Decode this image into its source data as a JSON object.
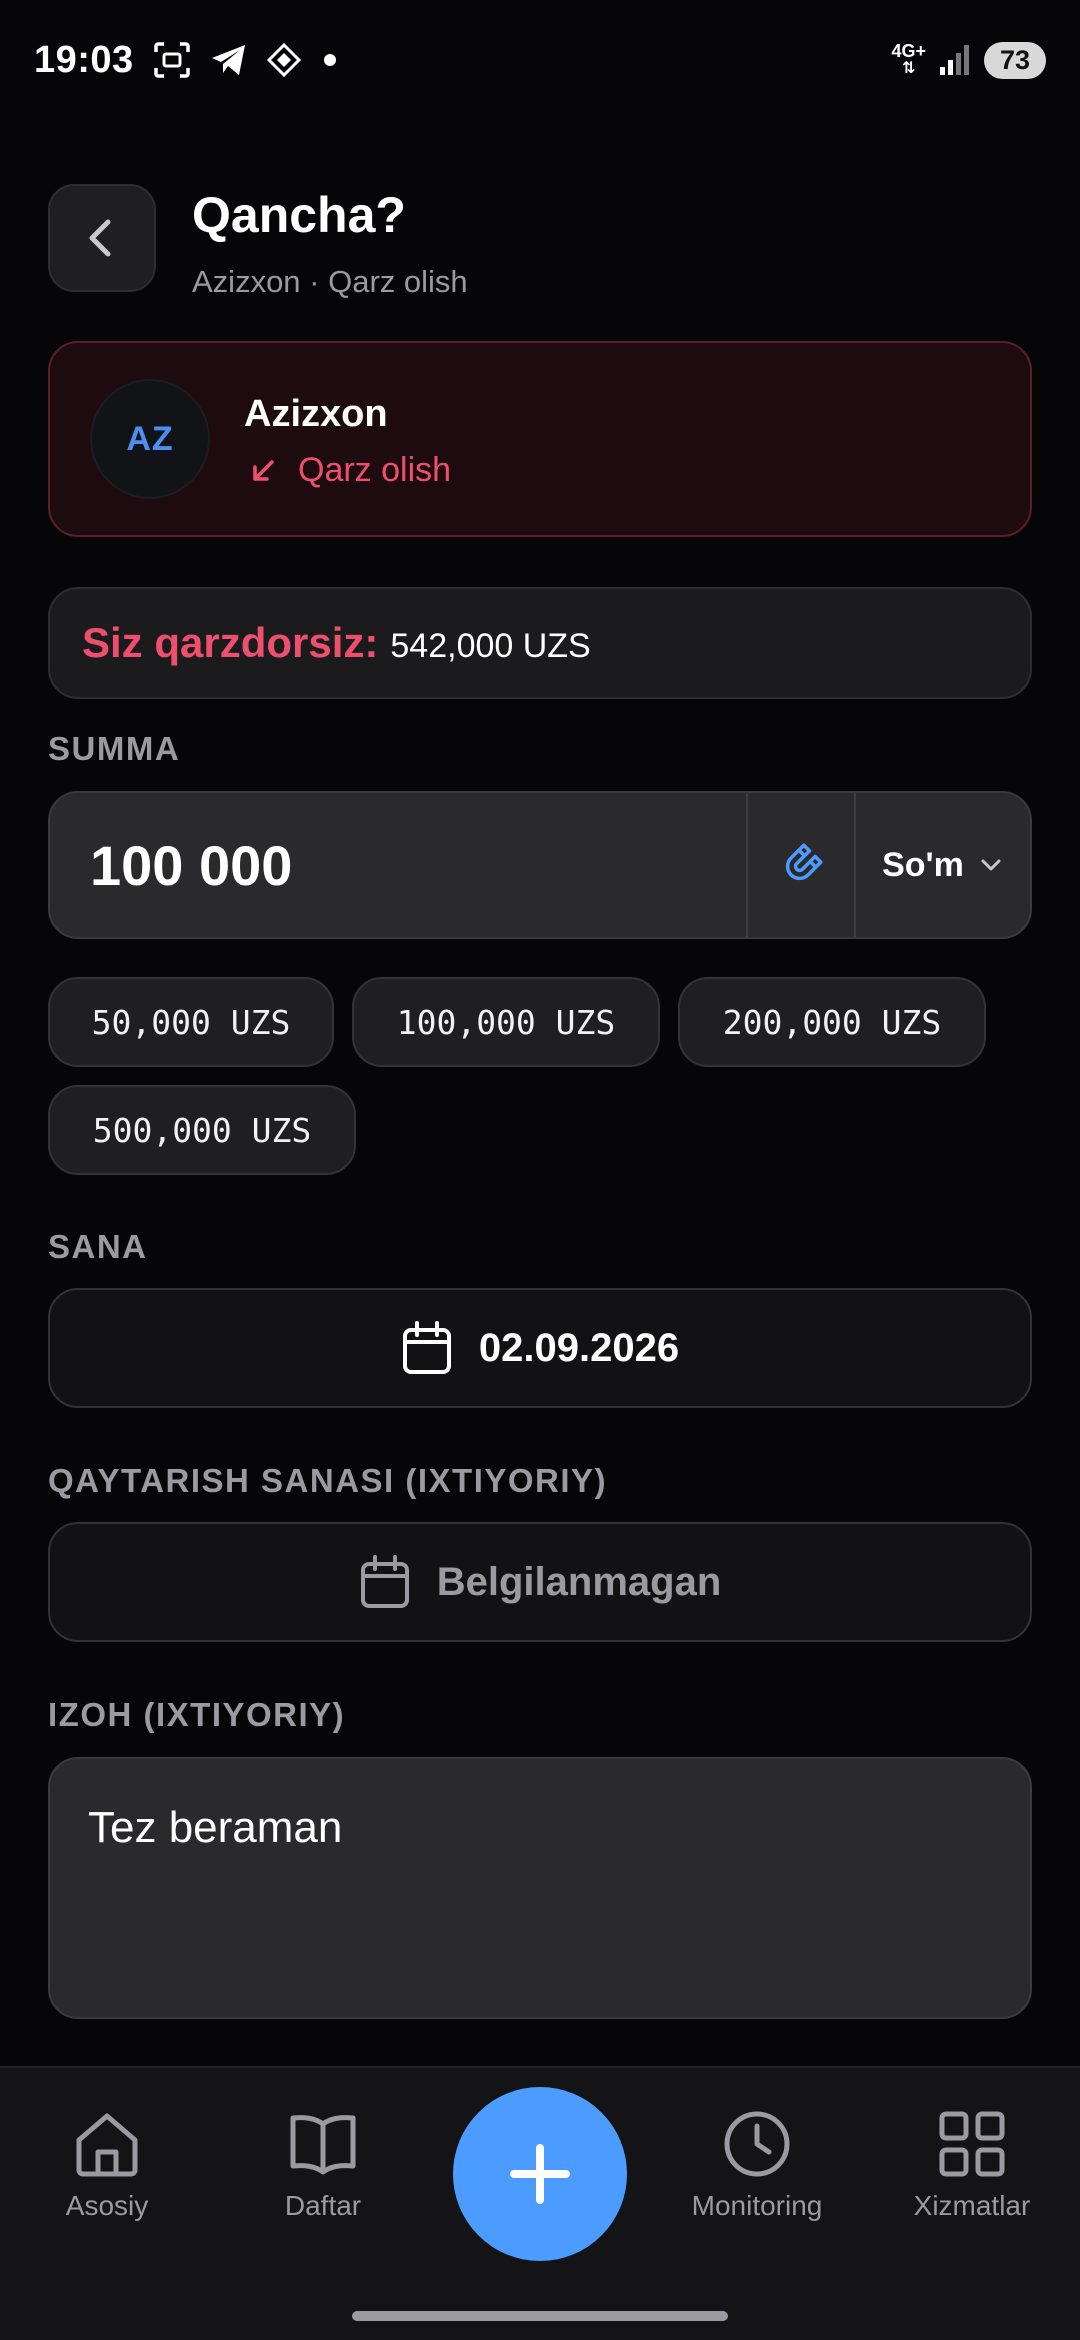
{
  "status_bar": {
    "time": "19:03",
    "network": "4G+",
    "battery": "73"
  },
  "header": {
    "title": "Qancha?",
    "subtitle": "Azizxon · Qarz olish"
  },
  "contact": {
    "initials": "AZ",
    "name": "Azizxon",
    "type_label": "Qarz olish"
  },
  "debt": {
    "label": "Siz qarzdorsiz:",
    "value": "542,000 UZS"
  },
  "amount": {
    "section_label": "SUMMA",
    "value": "100 000",
    "currency": "So'm",
    "quick_amounts": [
      "50,000 UZS",
      "100,000 UZS",
      "200,000 UZS",
      "500,000 UZS"
    ]
  },
  "date": {
    "section_label": "SANA",
    "value": "02.09.2026"
  },
  "return_date": {
    "section_label": "QAYTARISH SANASI (IXTIYORIY)",
    "placeholder": "Belgilanmagan"
  },
  "note": {
    "section_label": "IZOH (IXTIYORIY)",
    "value": "Tez beraman"
  },
  "nav": {
    "items": [
      {
        "label": "Asosiy",
        "icon": "home-icon"
      },
      {
        "label": "Daftar",
        "icon": "book-icon"
      },
      {
        "label": "Monitoring",
        "icon": "clock-icon"
      },
      {
        "label": "Xizmatlar",
        "icon": "grid-icon"
      }
    ],
    "fab_icon": "plus-icon"
  },
  "colors": {
    "background": "#060608",
    "accent_blue": "#4c9bff",
    "debt_red": "#ef4f6e",
    "muted_text": "#9a9aa0"
  }
}
